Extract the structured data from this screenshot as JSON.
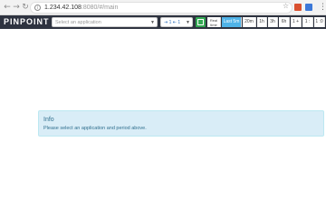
{
  "browser": {
    "url_host": "1.234.42.108",
    "url_path": ":8080/#/main",
    "back_icon": "arrow-left-icon",
    "forward_icon": "arrow-right-icon",
    "reload_icon": "reload-icon",
    "info_symbol": "i",
    "star_icon": "star-icon",
    "menu_icon": "kebab-menu-icon"
  },
  "header": {
    "logo": "PINPOINT",
    "app_select_placeholder": "Select an application",
    "depth_label": "⇥ 1  ⇤ 1",
    "period_buttons": [
      {
        "label": "Real time",
        "active": false
      },
      {
        "label": "Last 5m",
        "active": true
      },
      {
        "label": "20m",
        "active": false
      },
      {
        "label": "1h",
        "active": false
      },
      {
        "label": "3h",
        "active": false
      },
      {
        "label": "6h",
        "active": false
      },
      {
        "label": "1 +",
        "active": false
      },
      {
        "label": "1 :",
        "active": false
      },
      {
        "label": "1 :0",
        "active": false
      }
    ]
  },
  "info": {
    "title": "Info",
    "message": "Please select an application and period above."
  },
  "colors": {
    "header_bg": "#2e3340",
    "active_period": "#4fb3e8",
    "grid_button": "#34a853",
    "info_bg": "#d9edf7",
    "info_text": "#31708f"
  }
}
